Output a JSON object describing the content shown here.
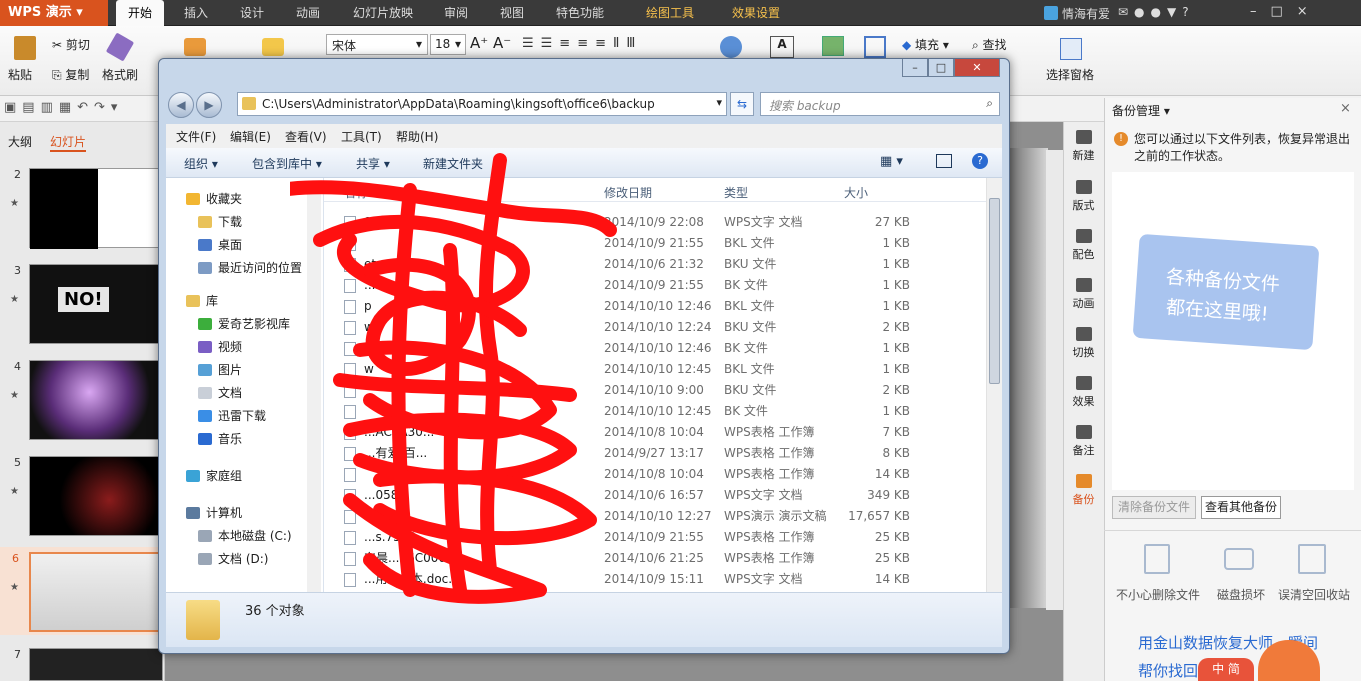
{
  "app": {
    "logo": "WPS 演示",
    "tabs": [
      "开始",
      "插入",
      "设计",
      "动画",
      "幻灯片放映",
      "审阅",
      "视图",
      "特色功能",
      "绘图工具",
      "效果设置"
    ],
    "active_tab": "开始",
    "user": "情海有爱"
  },
  "ribbon": {
    "paste": "粘贴",
    "cut": "剪切",
    "copy": "复制",
    "format_painter": "格式刷",
    "font": "宋体",
    "size": "18",
    "fill": "填充",
    "find": "查找",
    "selection_pane": "选择窗格"
  },
  "left_panel": {
    "tab_outline": "大纲",
    "tab_slides": "幻灯片",
    "slides": [
      "2",
      "3",
      "4",
      "5",
      "6",
      "7"
    ],
    "selected": "6",
    "thumb3_text": "NO!"
  },
  "right_bar": {
    "items": [
      "新建",
      "版式",
      "配色",
      "动画",
      "切换",
      "效果",
      "备注",
      "备份"
    ]
  },
  "backup_pane": {
    "title": "备份管理",
    "info": "您可以通过以下文件列表，恢复异常退出之前的工作状态。",
    "card_text_1": "各种备份文件",
    "card_text_2": "都在这里哦!",
    "clear_btn": "清除备份文件",
    "view_other_btn": "查看其他备份",
    "recover_items": [
      "不小心删除文件",
      "磁盘损坏",
      "误清空回收站"
    ],
    "ad_text_1": "用金山数据恢复大师，瞬间",
    "ad_text_2": "帮你找回",
    "ad_badge": "中 简"
  },
  "explorer": {
    "address": "C:\\Users\\Administrator\\AppData\\Roaming\\kingsoft\\office6\\backup",
    "search_placeholder": "搜索 backup",
    "menu": [
      "文件(F)",
      "编辑(E)",
      "查看(V)",
      "工具(T)",
      "帮助(H)"
    ],
    "commands": [
      "组织 ▾",
      "包含到库中 ▾",
      "共享 ▾",
      "新建文件夹"
    ],
    "nav": [
      {
        "label": "收藏夹",
        "icon": "star-icon",
        "header": true
      },
      {
        "label": "下载",
        "icon": "download-folder-icon"
      },
      {
        "label": "桌面",
        "icon": "desktop-icon"
      },
      {
        "label": "最近访问的位置",
        "icon": "recent-places-icon"
      },
      {
        "label": "库",
        "icon": "library-icon",
        "header": true
      },
      {
        "label": "爱奇艺影视库",
        "icon": "iqiyi-icon"
      },
      {
        "label": "视频",
        "icon": "video-icon"
      },
      {
        "label": "图片",
        "icon": "pictures-icon"
      },
      {
        "label": "文档",
        "icon": "documents-icon"
      },
      {
        "label": "迅雷下载",
        "icon": "thunder-icon"
      },
      {
        "label": "音乐",
        "icon": "music-icon"
      },
      {
        "label": "家庭组",
        "icon": "homegroup-icon",
        "header": true
      },
      {
        "label": "计算机",
        "icon": "computer-icon",
        "header": true
      },
      {
        "label": "本地磁盘 (C:)",
        "icon": "drive-icon"
      },
      {
        "label": "文档 (D:)",
        "icon": "drive-icon"
      }
    ],
    "columns": [
      "名称",
      "修改日期",
      "类型",
      "大小"
    ],
    "files": [
      {
        "name": "9637A84...",
        "date": "2014/10/9 22:08",
        "type": "WPS文字 文档",
        "size": "27 KB"
      },
      {
        "name": "",
        "date": "2014/10/9 21:55",
        "type": "BKL 文件",
        "size": "1 KB"
      },
      {
        "name": "et...u",
        "date": "2014/10/6 21:32",
        "type": "BKU 文件",
        "size": "1 KB"
      },
      {
        "name": "...20.bl",
        "date": "2014/10/9 21:55",
        "type": "BK 文件",
        "size": "1 KB"
      },
      {
        "name": "p",
        "date": "2014/10/10 12:46",
        "type": "BKL 文件",
        "size": "1 KB"
      },
      {
        "name": "w",
        "date": "2014/10/10 12:24",
        "type": "BKU 文件",
        "size": "2 KB"
      },
      {
        "name": "w",
        "date": "2014/10/10 12:46",
        "type": "BK 文件",
        "size": "1 KB"
      },
      {
        "name": "w",
        "date": "2014/10/10 12:45",
        "type": "BKL 文件",
        "size": "1 KB"
      },
      {
        "name": "",
        "date": "2014/10/10 9:00",
        "type": "BKU 文件",
        "size": "2 KB"
      },
      {
        "name": "",
        "date": "2014/10/10 12:45",
        "type": "BK 文件",
        "size": "1 KB"
      },
      {
        "name": "...ACEA30...",
        "date": "2014/10/8 10:04",
        "type": "WPS表格 工作簿",
        "size": "7 KB"
      },
      {
        "name": "...有爱-百...",
        "date": "2014/9/27 13:17",
        "type": "WPS表格 工作簿",
        "size": "8 KB"
      },
      {
        "name": "",
        "date": "2014/10/8 10:04",
        "type": "WPS表格 工作簿",
        "size": "14 KB"
      },
      {
        "name": "...058...",
        "date": "2014/10/6 16:57",
        "type": "WPS文字 文档",
        "size": "349 KB"
      },
      {
        "name": "...EDE...",
        "date": "2014/10/10 12:27",
        "type": "WPS演示 演示文稿",
        "size": "17,657 KB"
      },
      {
        "name": "...s.75E3...",
        "date": "2014/10/9 21:55",
        "type": "WPS表格 工作簿",
        "size": "25 KB"
      },
      {
        "name": "东晨...16C00002...",
        "date": "2014/10/6 21:25",
        "type": "WPS表格 工作簿",
        "size": "25 KB"
      },
      {
        "name": "...用空...本.doc...",
        "date": "2014/10/9 15:11",
        "type": "WPS文字 文档",
        "size": "14 KB"
      }
    ],
    "status": "36 个对象"
  },
  "colors": {
    "accent": "#d9531e",
    "scribble": "#ff0000"
  }
}
